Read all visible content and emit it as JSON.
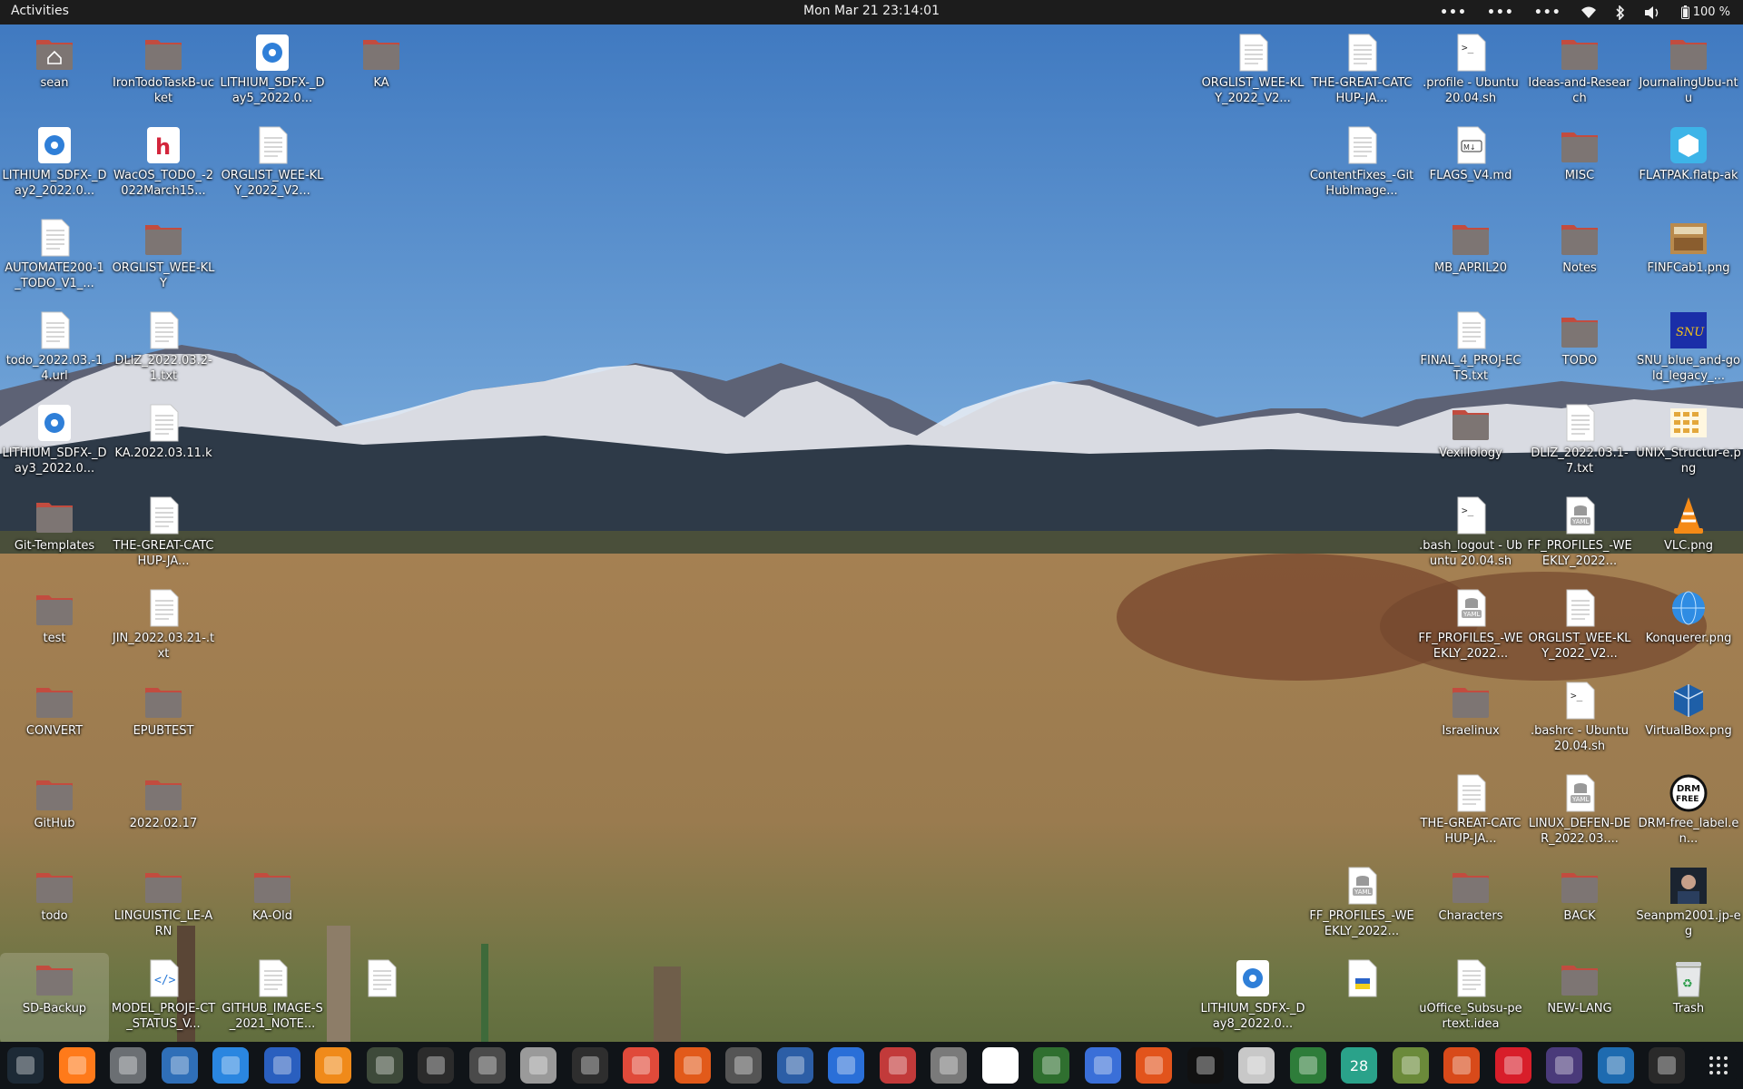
{
  "topbar": {
    "activities": "Activities",
    "clock": "Mon Mar 21  23:14:01",
    "battery": "100 %",
    "overflow_menus": [
      "•••",
      "•••",
      "•••"
    ]
  },
  "desktop": {
    "icons": [
      {
        "label": "sean",
        "type": "home"
      },
      {
        "label": "IronTodoTaskB-ucket",
        "type": "folder"
      },
      {
        "label": "LITHIUM_SDFX-_Day5_2022.0...",
        "type": "disc"
      },
      {
        "label": "KA",
        "type": "folder"
      },
      {
        "label": "LITHIUM_SDFX-_Day2_2022.0...",
        "type": "disc"
      },
      {
        "label": "WacOS_TODO_-2022March15...",
        "type": "app-h"
      },
      {
        "label": "ORGLIST_WEE-KLY_2022_V2...",
        "type": "text"
      },
      {
        "label": "AUTOMATE200-1_TODO_V1_...",
        "type": "text"
      },
      {
        "label": "ORGLIST_WEE-KLY",
        "type": "folder"
      },
      {
        "label": "todo_2022.03.-14.url",
        "type": "text"
      },
      {
        "label": "DLIZ_2022.03.2-1.txt",
        "type": "text"
      },
      {
        "label": "LITHIUM_SDFX-_Day3_2022.0...",
        "type": "disc"
      },
      {
        "label": "KA.2022.03.11.k",
        "type": "text"
      },
      {
        "label": "Git-Templates",
        "type": "folder"
      },
      {
        "label": "THE-GREAT-CATCHUP-JA...",
        "type": "text"
      },
      {
        "label": "test",
        "type": "folder"
      },
      {
        "label": "JIN_2022.03.21-.txt",
        "type": "text"
      },
      {
        "label": "CONVERT",
        "type": "folder"
      },
      {
        "label": "EPUBTEST",
        "type": "folder"
      },
      {
        "label": "GitHub",
        "type": "folder"
      },
      {
        "label": "2022.02.17",
        "type": "folder"
      },
      {
        "label": "todo",
        "type": "folder"
      },
      {
        "label": "LINGUISTIC_LE-ARN",
        "type": "folder"
      },
      {
        "label": "KA-Old",
        "type": "folder"
      },
      {
        "label": "SD-Backup",
        "type": "folder"
      },
      {
        "label": "MODEL_PROJE-CT_STATUS_V...",
        "type": "code"
      },
      {
        "label": "GITHUB_IMAGE-S_2021_NOTE...",
        "type": "text"
      },
      {
        "label": "",
        "type": "text"
      },
      {
        "label": "ORGLIST_WEE-KLY_2022_V2...",
        "type": "text"
      },
      {
        "label": "THE-GREAT-CATCHUP-JA...",
        "type": "text"
      },
      {
        "label": ".profile - Ubuntu 20.04.sh",
        "type": "script"
      },
      {
        "label": "Ideas-and-Research",
        "type": "folder"
      },
      {
        "label": "JournalingUbu-ntu",
        "type": "folder"
      },
      {
        "label": "ContentFixes_-GitHubImage...",
        "type": "text"
      },
      {
        "label": "FLAGS_V4.md",
        "type": "markdown"
      },
      {
        "label": "MISC",
        "type": "folder"
      },
      {
        "label": "FLATPAK.flatp-ak",
        "type": "package"
      },
      {
        "label": "MB_APRIL20",
        "type": "folder"
      },
      {
        "label": "Notes",
        "type": "folder"
      },
      {
        "label": "FINFCab1.png",
        "type": "image"
      },
      {
        "label": "FINAL_4_PROJ-ECTS.txt",
        "type": "text"
      },
      {
        "label": "TODO",
        "type": "folder"
      },
      {
        "label": "SNU_blue_and-gold_legacy_...",
        "type": "image-snu"
      },
      {
        "label": "Vexillology",
        "type": "folder"
      },
      {
        "label": "DLIZ_2022.03.1-7.txt",
        "type": "text"
      },
      {
        "label": "UNIX_Structur-e.png",
        "type": "image-grid"
      },
      {
        "label": ".bash_logout - Ubuntu 20.04.sh",
        "type": "script"
      },
      {
        "label": "FF_PROFILES_-WEEKLY_2022...",
        "type": "yaml"
      },
      {
        "label": "VLC.png",
        "type": "vlc"
      },
      {
        "label": "FF_PROFILES_-WEEKLY_2022...",
        "type": "yaml"
      },
      {
        "label": "ORGLIST_WEE-KLY_2022_V2...",
        "type": "text"
      },
      {
        "label": "Konquerer.png",
        "type": "globe"
      },
      {
        "label": "Israelinux",
        "type": "folder"
      },
      {
        "label": ".bashrc - Ubuntu 20.04.sh",
        "type": "script"
      },
      {
        "label": "VirtualBox.png",
        "type": "vbox"
      },
      {
        "label": "THE-GREAT-CATCHUP-JA...",
        "type": "text"
      },
      {
        "label": "LINUX_DEFEN-DER_2022.03....",
        "type": "yaml"
      },
      {
        "label": "DRM-free_label.en...",
        "type": "drm"
      },
      {
        "label": "FF_PROFILES_-WEEKLY_2022...",
        "type": "yaml"
      },
      {
        "label": "Characters",
        "type": "folder"
      },
      {
        "label": "BACK",
        "type": "folder"
      },
      {
        "label": "Seanpm2001.jp-eg",
        "type": "photo"
      },
      {
        "label": "LITHIUM_SDFX-_Day8_2022.0...",
        "type": "disc"
      },
      {
        "label": "",
        "type": "text-flag"
      },
      {
        "label": "uOffice_Subsu-pertext.idea",
        "type": "text"
      },
      {
        "label": "NEW-LANG",
        "type": "folder"
      },
      {
        "label": "Trash",
        "type": "trash"
      }
    ]
  },
  "dock": {
    "calendar_day": "28",
    "apps": [
      "system-monitor",
      "firefox",
      "settings",
      "document-viewer",
      "help",
      "text-editor",
      "vlc",
      "extension-manager",
      "terminal",
      "image-search",
      "files",
      "calculator",
      "system-monitor-graph",
      "app-store",
      "disk-usage",
      "font-viewer",
      "todo",
      "screenshot",
      "archive",
      "character-map",
      "vim",
      "workspaces",
      "update-manager",
      "music",
      "document-scanner",
      "spreadsheet",
      "calendar",
      "pidgin",
      "game",
      "alert",
      "screen-recorder",
      "app-store-2",
      "software-updater",
      "show-apps"
    ]
  },
  "colors": {
    "folder": "#7d7573",
    "folder_tab": "#c24c3f",
    "topbar": "#1c1c1c",
    "dock": "#101418"
  }
}
